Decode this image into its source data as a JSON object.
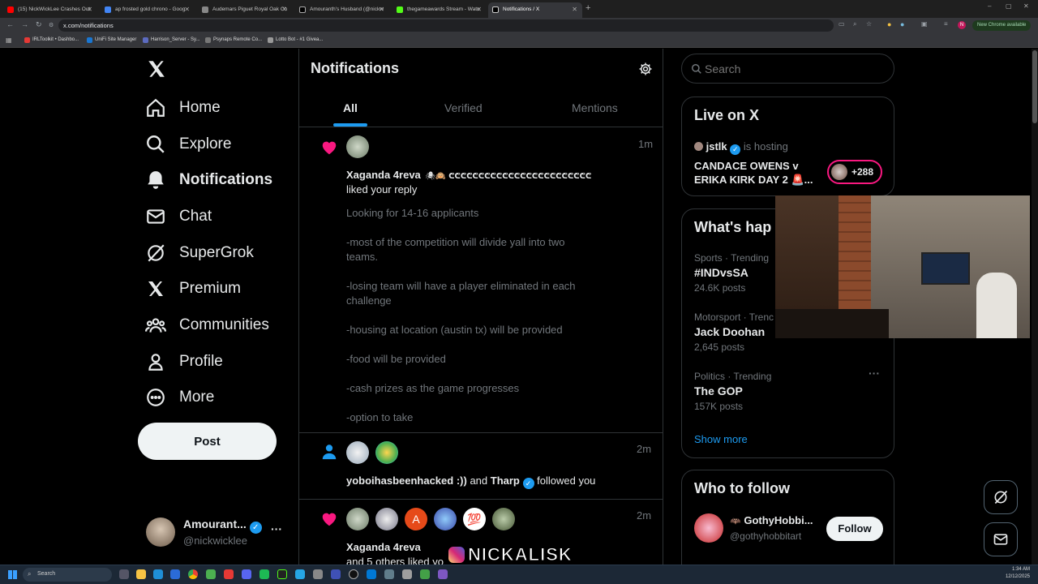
{
  "browser": {
    "tabs": [
      {
        "title": "(15) NickWickLee Crashes Out",
        "active": false
      },
      {
        "title": "ap frosted gold chrono - Goog",
        "active": false
      },
      {
        "title": "Audemars Piguet Royal Oak Ch",
        "active": false
      },
      {
        "title": "Amouranth's Husband (@nickw",
        "active": false
      },
      {
        "title": "thegameawards Stream - Watc",
        "active": false
      },
      {
        "title": "Notifications / X",
        "active": true
      }
    ],
    "url": "x.com/notifications",
    "update_label": "New Chrome available",
    "profile_initial": "N",
    "bookmarks": [
      "IRLToolkit • Dashbo...",
      "UniFi Site Manager",
      "Harrison_Server - Sy...",
      "Psynaps Remote Co...",
      "Lotto Bot - #1 Givea..."
    ]
  },
  "nav": {
    "items": [
      "Home",
      "Explore",
      "Notifications",
      "Chat",
      "SuperGrok",
      "Premium",
      "Communities",
      "Profile",
      "More"
    ],
    "post_label": "Post",
    "account": {
      "name": "Amourant...",
      "handle": "@nickwicklee",
      "more": "···"
    }
  },
  "main": {
    "title": "Notifications",
    "tabs": [
      "All",
      "Verified",
      "Mentions"
    ],
    "notifications": [
      {
        "time": "1m",
        "user": "Xaganda 4reva",
        "suffix": "ᕦᕦᕦᕦᕦᕦᕦᕦᕦᕦᕦᕦᕦᕦᕦᕦᕦᕦᕦᕦᕦᕦᕦᕦ",
        "action": "liked your reply",
        "lines": [
          "Looking for 14-16 applicants",
          "-most of the competition will divide yall into two",
          "teams.",
          "-losing team will have a player eliminated in each",
          "challenge",
          "-housing at location (austin tx) will be provided",
          "-food will be provided",
          "-cash prizes as the game progresses",
          "-option to take"
        ]
      },
      {
        "time": "2m",
        "user": "yoboihasbeenhacked :))",
        "and": "and",
        "user2": "Tharp",
        "action": "followed you"
      },
      {
        "time": "2m",
        "user": "Xaganda 4reva",
        "action": "and 5 others liked yo",
        "avatar_letter": "A",
        "emoji": "💯"
      }
    ]
  },
  "search": {
    "placeholder": "Search"
  },
  "live": {
    "title": "Live on X",
    "host": "jstlk",
    "hosting": "is hosting",
    "stream_title": "CANDACE OWENS v ERIKA KIRK DAY 2 🚨...",
    "count": "+288"
  },
  "trends": {
    "title": "What's hap",
    "items": [
      {
        "context": "Sports · Trending",
        "name": "#INDvsSA",
        "posts": "24.6K posts"
      },
      {
        "context": "Motorsport · Trenc",
        "name": "Jack Doohan",
        "posts": "2,645 posts"
      },
      {
        "context": "Politics · Trending",
        "name": "The GOP",
        "posts": "157K posts"
      }
    ],
    "show_more": "Show more"
  },
  "follow": {
    "title": "Who to follow",
    "name": "GothyHobbi...",
    "handle": "@gothyhobbitart",
    "button": "Follow"
  },
  "overlay": {
    "watermark": "NICKALISK"
  },
  "taskbar": {
    "search": "Search",
    "time": "1:34 AM",
    "date": "12/12/2025"
  },
  "colors": {
    "accent": "#1d9bf0",
    "like": "#f91880",
    "bg": "#000000",
    "border": "#2f3336"
  }
}
